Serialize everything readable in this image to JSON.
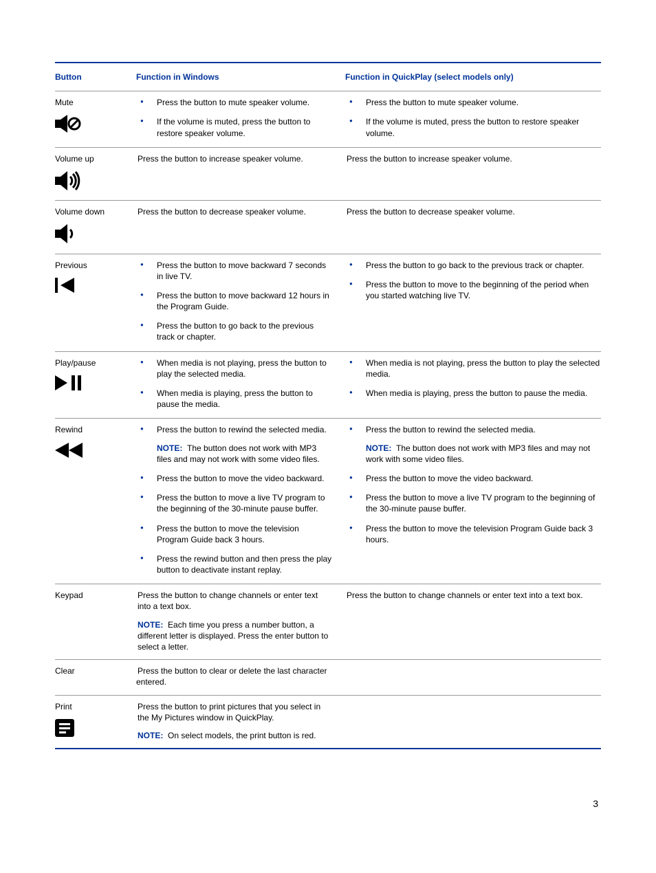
{
  "headers": {
    "button": "Button",
    "windows": "Function in Windows",
    "quickplay": "Function in QuickPlay (select models only)"
  },
  "note_label": "NOTE:",
  "rows": {
    "mute": {
      "label": "Mute",
      "win": {
        "bullets": [
          "Press the button to mute speaker volume.",
          "If the volume is muted, press the button to restore speaker volume."
        ]
      },
      "qp": {
        "bullets": [
          "Press the button to mute speaker volume.",
          "If the volume is muted, press the button to restore speaker volume."
        ]
      }
    },
    "volume_up": {
      "label": "Volume up",
      "win": "Press the button to increase speaker volume.",
      "qp": "Press the button to increase speaker volume."
    },
    "volume_down": {
      "label": "Volume down",
      "win": "Press the button to decrease speaker volume.",
      "qp": "Press the button to decrease speaker volume."
    },
    "previous": {
      "label": "Previous",
      "win": {
        "bullets": [
          "Press the button to move backward 7 seconds in live TV.",
          "Press the button to move backward 12 hours in the Program Guide.",
          "Press the button to go back to the previous track or chapter."
        ]
      },
      "qp": {
        "bullets": [
          "Press the button to go back to the previous track or chapter.",
          "Press the button to move to the beginning of the period when you started watching live TV."
        ]
      }
    },
    "play_pause": {
      "label": "Play/pause",
      "win": {
        "bullets": [
          "When media is not playing, press the button to play the selected media.",
          "When media is playing, press the button to pause the media."
        ]
      },
      "qp": {
        "bullets": [
          "When media is not playing, press the button to play the selected media.",
          "When media is playing, press the button to pause the media."
        ]
      }
    },
    "rewind": {
      "label": "Rewind",
      "win": {
        "b0": "Press the button to rewind the selected media.",
        "note0": "The button does not work with MP3 files and may not work with some video files.",
        "b1": "Press the button to move the video backward.",
        "b2": "Press the button to move a live TV program to the beginning of the 30-minute pause buffer.",
        "b3": "Press the button to move the television Program Guide back 3 hours.",
        "b4": "Press the rewind button and then press the play button to deactivate instant replay."
      },
      "qp": {
        "b0": "Press the button to rewind the selected media.",
        "note0": "The button does not work with MP3 files and may not work with some video files.",
        "b1": "Press the button to move the video backward.",
        "b2": "Press the button to move a live TV program to the beginning of the 30-minute pause buffer.",
        "b3": "Press the button to move the television Program Guide back 3 hours."
      }
    },
    "keypad": {
      "label": "Keypad",
      "win": {
        "text": "Press the button to change channels or enter text into a text box.",
        "note": "Each time you press a number button, a different letter is displayed. Press the enter button to select a letter."
      },
      "qp": "Press the button to change channels or enter text into a text box."
    },
    "clear": {
      "label": "Clear",
      "win": "Press the button to clear or delete the last character entered."
    },
    "print": {
      "label": "Print",
      "win": {
        "text": "Press the button to print pictures that you select in the My Pictures window in QuickPlay.",
        "note": "On select models, the print button is red."
      }
    }
  },
  "page_number": "3"
}
